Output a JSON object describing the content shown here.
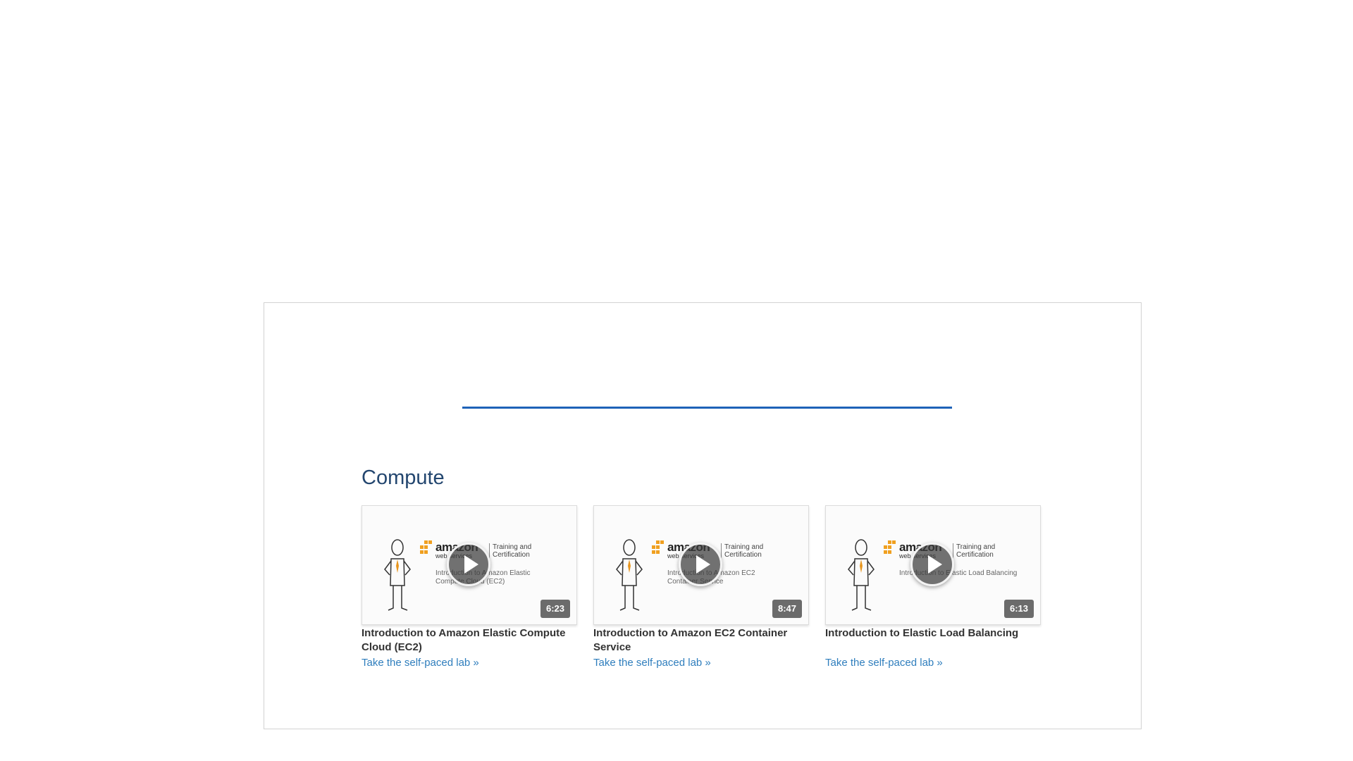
{
  "section": {
    "title": "Compute"
  },
  "cards": [
    {
      "duration": "6:23",
      "title": "Introduction to Amazon Elastic Compute Cloud (EC2)",
      "link": "Take the self-paced lab »",
      "thumb": {
        "logo": "amazon",
        "logo_sub": "web services",
        "training": "Training and Certification",
        "video_title": "Introduction to Amazon Elastic Compute Cloud (EC2)"
      }
    },
    {
      "duration": "8:47",
      "title": "Introduction to Amazon EC2 Container Service",
      "link": "Take the self-paced lab »",
      "thumb": {
        "logo": "amazon",
        "logo_sub": "web services",
        "training": "Training and Certification",
        "video_title": "Introduction to Amazon EC2 Container Service"
      }
    },
    {
      "duration": "6:13",
      "title": "Introduction to Elastic Load Balancing",
      "link": "Take the self-paced lab »",
      "thumb": {
        "logo": "amazon",
        "logo_sub": "web services",
        "training": "Training and Certification",
        "video_title": "Introduction to Elastic Load Balancing"
      }
    }
  ],
  "icons": {
    "play": "play-icon",
    "figure": "stick-figure-illustration",
    "logo": "aws-logo"
  },
  "colors": {
    "accent_line": "#1f62b8",
    "section_title": "#23466f",
    "link": "#2f7ebd",
    "duration_badge": "#6b6b6b"
  }
}
